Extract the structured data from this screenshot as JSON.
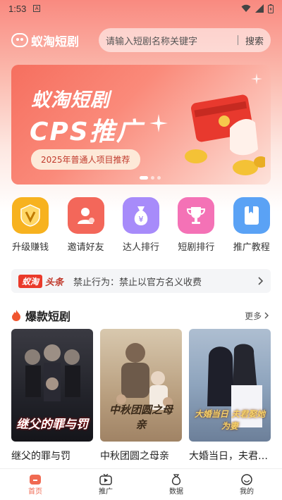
{
  "status": {
    "time": "1:53",
    "notif": "A"
  },
  "header": {
    "app_name": "蚁淘短剧",
    "search_placeholder": "请输入短剧名称关键字",
    "search_button": "搜索"
  },
  "banner": {
    "title": "蚁淘短剧",
    "subtitle": "CPS推广",
    "pill": "2025年普通人项目推荐"
  },
  "grid": [
    {
      "label": "升级赚钱",
      "icon": "upgrade-v-icon",
      "color": "#f7b21f"
    },
    {
      "label": "邀请好友",
      "icon": "invite-user-icon",
      "color": "#f3675a"
    },
    {
      "label": "达人排行",
      "icon": "money-bag-icon",
      "color": "#a78bfa"
    },
    {
      "label": "短剧排行",
      "icon": "trophy-icon",
      "color": "#f472b6"
    },
    {
      "label": "推广教程",
      "icon": "book-icon",
      "color": "#5aa2f5"
    }
  ],
  "notice": {
    "tag": "蚁淘",
    "tag2": "头条",
    "message": "禁止行为：禁止以官方名义收费"
  },
  "section": {
    "title": "爆款短剧",
    "more": "更多"
  },
  "cards": [
    {
      "title": "继父的罪与罚",
      "poster_text": "继父的罪与罚"
    },
    {
      "title": "中秋团圆之母亲",
      "poster_text": "中秋团圆之母亲"
    },
    {
      "title": "大婚当日，夫君…",
      "poster_text": "大婚当日 夫君娶她为妻"
    }
  ],
  "tabs": [
    {
      "label": "首页",
      "active": true
    },
    {
      "label": "推广",
      "active": false
    },
    {
      "label": "数据",
      "active": false
    },
    {
      "label": "我的",
      "active": false
    }
  ]
}
